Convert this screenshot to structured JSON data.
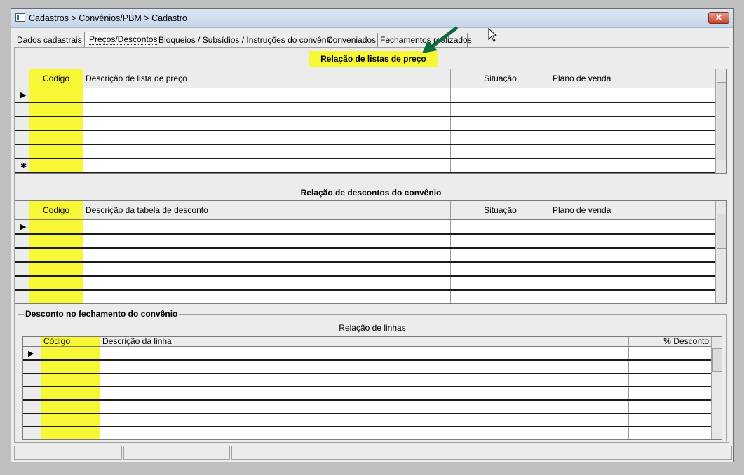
{
  "window": {
    "title": "Cadastros > Convênios/PBM > Cadastro",
    "close_label": "✕"
  },
  "tabs": [
    {
      "label": "Dados cadastrais"
    },
    {
      "label": "Preços/Descontos",
      "active": true
    },
    {
      "label": "Bloqueios / Subsídios / Instruções do convênio"
    },
    {
      "label": "Conveniados"
    },
    {
      "label": "Fechamentos realizados"
    }
  ],
  "price_lists": {
    "title": "Relação de listas de preço",
    "columns": [
      "Codigo",
      "Descrição de lista de preço",
      "Situação",
      "Plano de venda"
    ],
    "current_row_marker": "▶",
    "new_row_marker": "✱"
  },
  "discounts": {
    "title": "Relação de descontos do convênio",
    "columns": [
      "Codigo",
      "Descrição da tabela de desconto",
      "Situação",
      "Plano de venda"
    ],
    "current_row_marker": "▶"
  },
  "closing_discount": {
    "group_title": "Desconto no fechamento do convênio",
    "subtitle": "Relação de linhas",
    "columns": [
      "Código",
      "Descrição da linha",
      "% Desconto"
    ],
    "current_row_marker": "▶"
  },
  "colors": {
    "highlight": "#f7f736",
    "arrow": "#0f6b3c"
  },
  "icons": {
    "arrow": "green-arrow-icon",
    "cursor": "mouse-cursor-icon"
  }
}
